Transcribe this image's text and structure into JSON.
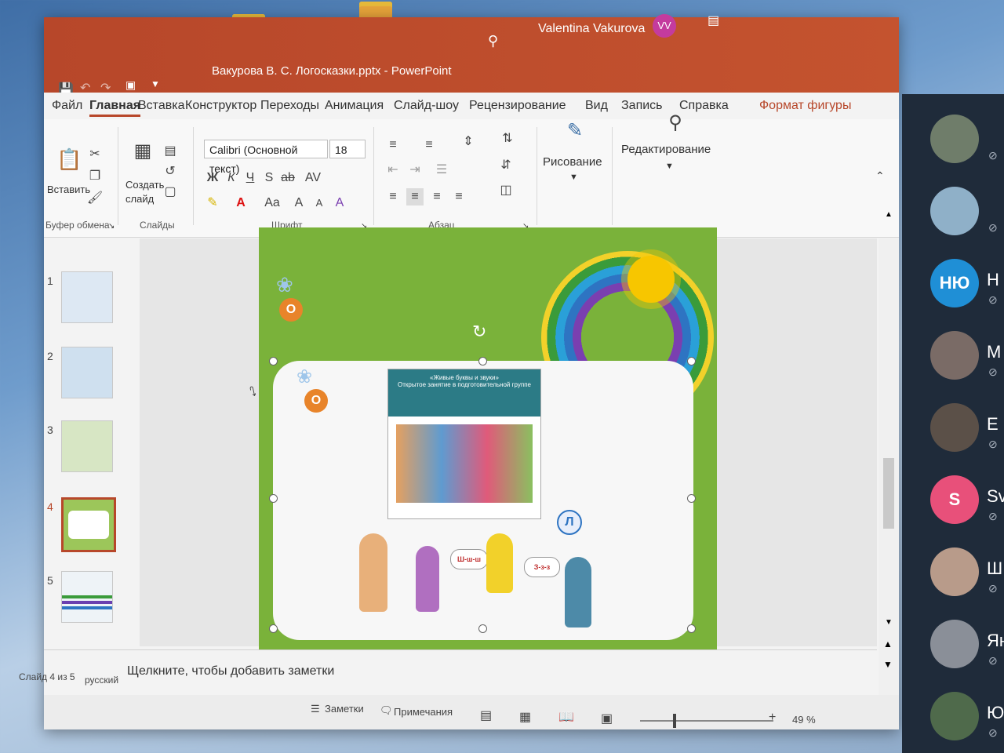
{
  "window": {
    "file_title": "Вакурова В. С. Логосказки.pptx",
    "app_name": "PowerPoint",
    "separator": "-",
    "user_name": "Valentina Vakurova",
    "user_initials": "VV",
    "brand_color": "#b7472a"
  },
  "tabs": [
    "Файл",
    "Главная",
    "Вставка",
    "Конструктор",
    "Переходы",
    "Анимация",
    "Слайд-шоу",
    "Рецензирование",
    "Вид",
    "Запись",
    "Справка",
    "Формат фигуры"
  ],
  "active_tab": "Главная",
  "ribbon": {
    "clipboard": {
      "paste_label": "Вставить",
      "group_label": "Буфер обмена"
    },
    "slides": {
      "new_slide_line1": "Создать",
      "new_slide_line2": "слайд",
      "group_label": "Слайды"
    },
    "font": {
      "font_name": "Calibri (Основной текст)",
      "font_size": "18",
      "bold": "Ж",
      "italic": "К",
      "underline": "Ч",
      "shadow": "S",
      "strike": "ab",
      "spacing": "AV",
      "case": "Aa",
      "grow": "A",
      "shrink": "A",
      "group_label": "Шрифт"
    },
    "paragraph": {
      "group_label": "Абзац"
    },
    "drawing": {
      "label": "Рисование"
    },
    "editing": {
      "label": "Редактирование"
    }
  },
  "thumbnails": [
    {
      "num": "1"
    },
    {
      "num": "2"
    },
    {
      "num": "3"
    },
    {
      "num": "4",
      "selected": true
    },
    {
      "num": "5"
    }
  ],
  "slide": {
    "letter_o_top": "О",
    "letter_o_mid": "О",
    "letter_l": "Л",
    "bubble1": "Ш-ш-ш",
    "bubble2": "З-з-з",
    "pic_title": "«Живые буквы и звуки»",
    "pic_subtitle": "Открытое занятие в подготовительной группе"
  },
  "notes_placeholder": "Щелкните, чтобы добавить заметки",
  "status": {
    "slide_info": "Слайд 4 из 5",
    "language": "русский",
    "notes_btn": "Заметки",
    "comments_btn": "Примечания",
    "zoom": "49 %"
  },
  "participants": [
    {
      "initials": "",
      "name": "",
      "color": "#6f7d6a"
    },
    {
      "initials": "",
      "name": "",
      "color": "#8fb0c8"
    },
    {
      "initials": "НЮ",
      "name": "Н",
      "color": "#1f8fd6"
    },
    {
      "initials": "",
      "name": "М",
      "color": "#7a6b66"
    },
    {
      "initials": "",
      "name": "Е",
      "color": "#5b5048"
    },
    {
      "initials": "S",
      "name": "Sv",
      "color": "#e8507a"
    },
    {
      "initials": "",
      "name": "Ш",
      "color": "#b89b8a"
    },
    {
      "initials": "",
      "name": "Ян",
      "color": "#8a8f98"
    },
    {
      "initials": "",
      "name": "Ю",
      "color": "#4f6a4b"
    }
  ]
}
